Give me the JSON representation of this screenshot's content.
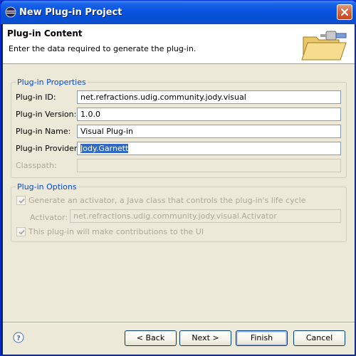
{
  "window": {
    "title": "New Plug-in Project"
  },
  "header": {
    "title": "Plug-in Content",
    "description": "Enter the data required to generate the plug-in."
  },
  "properties_group": {
    "legend_part1": "Plug-in ",
    "legend_part2": "Properties",
    "id_label": "Plug-in ID:",
    "id_value": "net.refractions.udig.community.jody.visual",
    "version_label": "Plug-in Version:",
    "version_value": "1.0.0",
    "name_label": "Plug-in Name:",
    "name_value": "Visual Plug-in",
    "provider_label": "Plug-in Provider:",
    "provider_value": "Jody.Garnett",
    "classpath_label": "Classpath:",
    "classpath_value": ""
  },
  "options_group": {
    "legend_part1": "Plug-in ",
    "legend_part2": "Options",
    "activator_checkbox_label": "Generate an activator, a Java class that controls the plug-in's life cycle",
    "activator_checked": true,
    "activator_label": "Activator:",
    "activator_value": "net.refractions.udig.community.jody.visual.Activator",
    "ui_checkbox_label": "This plug-in will make contributions to the UI",
    "ui_checked": true
  },
  "buttons": {
    "back": "< Back",
    "next": "Next >",
    "finish": "Finish",
    "cancel": "Cancel"
  },
  "colors": {
    "titlebar": "#0a56e0",
    "accent": "#0046d5",
    "disabled_text": "#aca899",
    "selection": "#316ac5"
  },
  "icons": {
    "title_icon": "eclipse-icon",
    "close_icon": "close-icon",
    "header_icon": "folder-plug-icon",
    "help_icon": "help-icon"
  }
}
